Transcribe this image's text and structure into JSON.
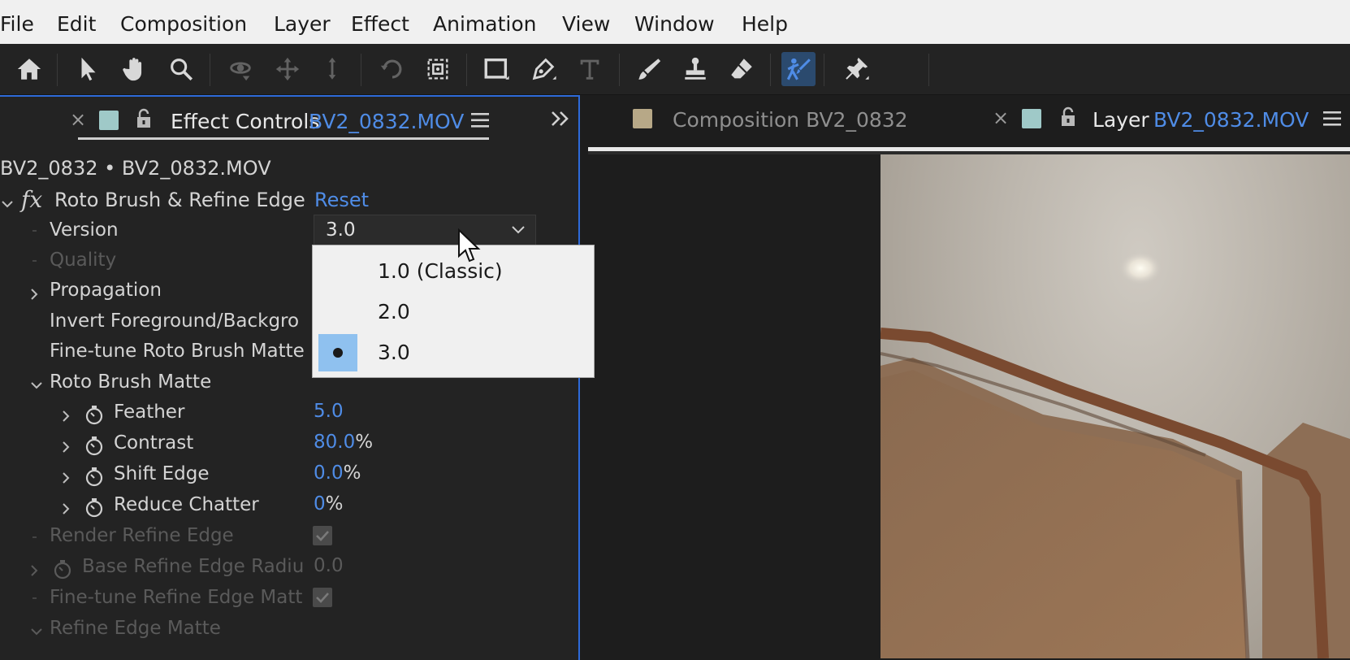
{
  "menubar": [
    "File",
    "Edit",
    "Composition",
    "Layer",
    "Effect",
    "Animation",
    "View",
    "Window",
    "Help"
  ],
  "toolbar": {
    "tools": [
      "home-icon",
      "selection-tool-icon",
      "hand-tool-icon",
      "zoom-tool-icon",
      "orbit-camera-icon",
      "pan-camera-icon",
      "dolly-camera-icon",
      "rotation-tool-icon",
      "pan-behind-tool-icon",
      "rectangle-tool-icon",
      "pen-tool-icon",
      "type-tool-icon",
      "brush-tool-icon",
      "clone-stamp-tool-icon",
      "eraser-tool-icon",
      "roto-brush-tool-icon",
      "puppet-pin-tool-icon"
    ]
  },
  "left_panel": {
    "tab_title": "Effect Controls",
    "tab_file": "BV2_0832.MOV",
    "layer_path": "BV2_0832 • BV2_0832.MOV",
    "effect_name": "Roto Brush & Refine Edge",
    "reset_label": "Reset",
    "rows": {
      "version": {
        "label": "Version",
        "value": "3.0"
      },
      "quality": {
        "label": "Quality"
      },
      "propagation": {
        "label": "Propagation"
      },
      "invert": {
        "label": "Invert Foreground/Backgro"
      },
      "finetune_roto": {
        "label": "Fine-tune Roto Brush Matte"
      },
      "roto_matte": {
        "label": "Roto Brush Matte"
      },
      "feather": {
        "label": "Feather",
        "value": "5.0"
      },
      "contrast": {
        "label": "Contrast",
        "value": "80.0",
        "unit": "%"
      },
      "shift_edge": {
        "label": "Shift Edge",
        "value": "0.0",
        "unit": "%"
      },
      "reduce_chatter": {
        "label": "Reduce Chatter",
        "value": "0",
        "unit": "%"
      },
      "render_refine": {
        "label": "Render Refine Edge",
        "checked": true
      },
      "base_refine": {
        "label": "Base Refine Edge Radiu",
        "value": "0.0"
      },
      "finetune_refine": {
        "label": "Fine-tune Refine Edge Matt",
        "checked": true
      },
      "refine_matte": {
        "label": "Refine Edge Matte"
      }
    }
  },
  "dropdown": {
    "options": [
      "1.0 (Classic)",
      "2.0",
      "3.0"
    ],
    "selected": "3.0"
  },
  "right_panel": {
    "composition_tab": "Composition BV2_0832",
    "layer_tab_title": "Layer",
    "layer_tab_file": "BV2_0832.MOV"
  },
  "colors": {
    "accent": "#4f8ce6",
    "composition_swatch": "#b7a887",
    "layer_swatch": "#9fc9c8",
    "selected_marker": "#8fc1ef"
  }
}
